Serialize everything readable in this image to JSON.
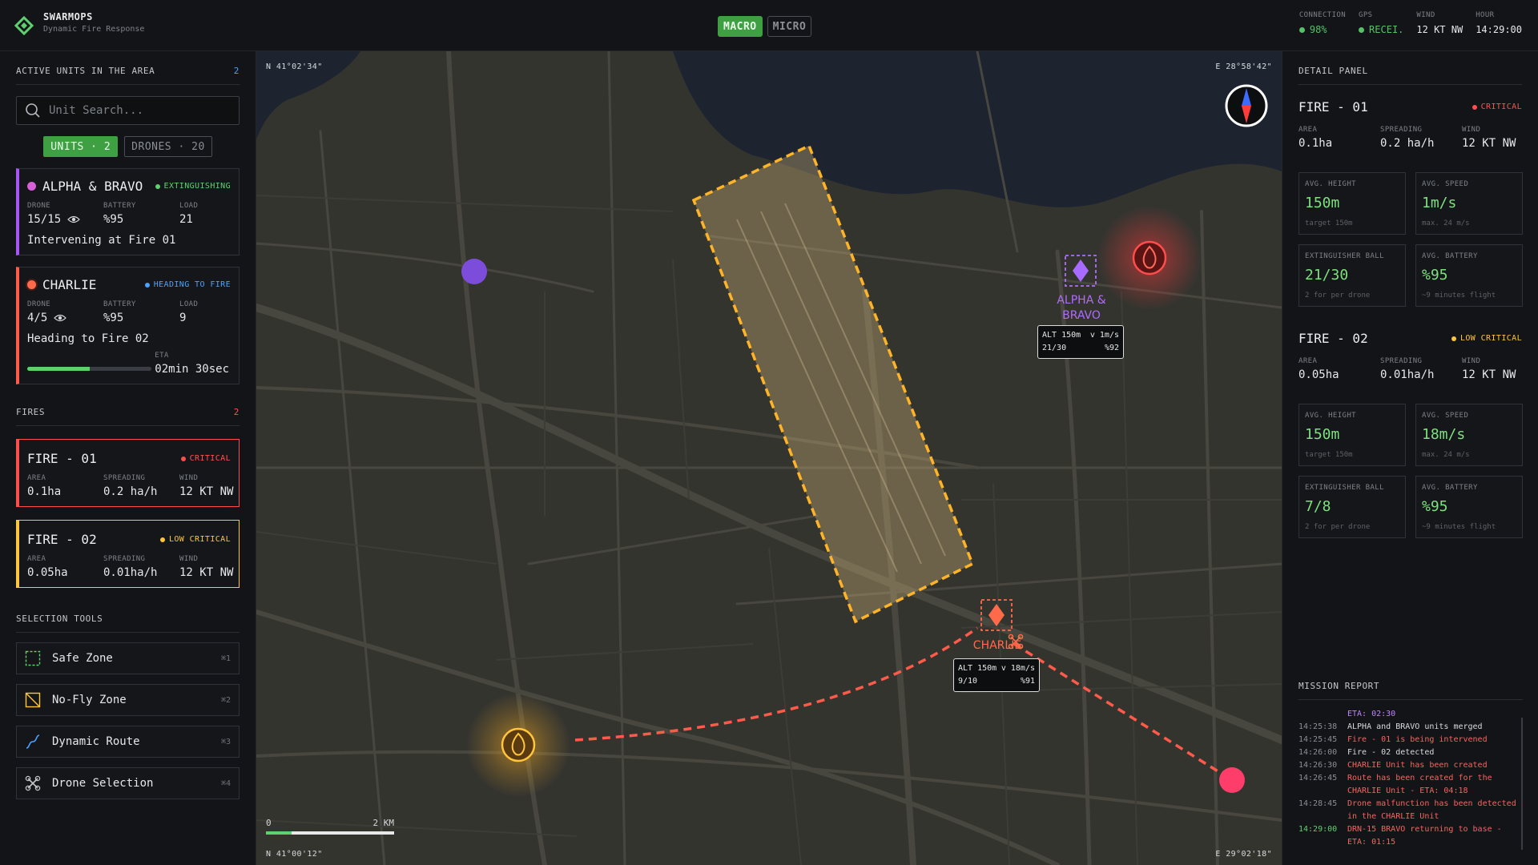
{
  "app": {
    "name": "SWARMOPS",
    "subtitle": "Dynamic Fire Response"
  },
  "mode": {
    "macro": "MACRO",
    "micro": "MICRO",
    "active": "MACRO"
  },
  "status": {
    "connection": {
      "label": "CONNECTION",
      "value": "98%"
    },
    "gps": {
      "label": "GPS",
      "value": "RECEI."
    },
    "wind": {
      "label": "WIND",
      "value": "12 KT NW"
    },
    "hour": {
      "label": "HOUR",
      "value": "14:29:00"
    }
  },
  "left": {
    "units_title": "ACTIVE UNITS IN THE AREA",
    "units_count": "2",
    "search_placeholder": "Unit Search...",
    "filter_units": "UNITS · 2",
    "filter_drones": "DRONES · 20",
    "units": [
      {
        "name": "ALPHA & BRAVO",
        "status": "EXTINGUISHING",
        "drone_label": "DRONE",
        "drone": "15/15",
        "battery_label": "BATTERY",
        "battery": "%95",
        "load_label": "LOAD",
        "load": "21",
        "note": "Intervening at Fire 01",
        "color": "#d75fd7"
      },
      {
        "name": "CHARLIE",
        "status": "HEADING TO FIRE",
        "drone_label": "DRONE",
        "drone": "4/5",
        "battery_label": "BATTERY",
        "battery": "%95",
        "load_label": "LOAD",
        "load": "9",
        "note": "Heading to Fire 02",
        "eta_label": "ETA",
        "eta": "02min 30sec",
        "progress": 0.5,
        "color": "#ff6b4a"
      }
    ],
    "fires_title": "FIRES",
    "fires_count": "2",
    "fires": [
      {
        "name": "FIRE - 01",
        "status": "CRITICAL",
        "area_label": "AREA",
        "area": "0.1ha",
        "spreading_label": "SPREADING",
        "spreading": "0.2 ha/h",
        "wind_label": "WIND",
        "wind": "12 KT NW"
      },
      {
        "name": "FIRE - 02",
        "status": "LOW CRITICAL",
        "area_label": "AREA",
        "area": "0.05ha",
        "spreading_label": "SPREADING",
        "spreading": "0.01ha/h",
        "wind_label": "WIND",
        "wind": "12 KT NW"
      }
    ],
    "tools_title": "SELECTION TOOLS",
    "tools": [
      {
        "label": "Safe Zone",
        "key": "⌘1"
      },
      {
        "label": "No-Fly Zone",
        "key": "⌘2"
      },
      {
        "label": "Dynamic Route",
        "key": "⌘3"
      },
      {
        "label": "Drone Selection",
        "key": "⌘4"
      }
    ]
  },
  "map": {
    "coord_tl": "N 41°02'34\"",
    "coord_tr": "E 28°58'42\"",
    "coord_bl": "N 41°00'12\"",
    "coord_br": "E 29°02'18\"",
    "alpha_label_1": "ALPHA &",
    "alpha_label_2": "BRAVO",
    "alpha_alt": "ALT 150m",
    "alpha_speed": "v 1m/s",
    "alpha_load": "21/30",
    "alpha_batt": "%92",
    "charlie_label": "CHARLIE",
    "charlie_alt": "ALT 150m",
    "charlie_speed": "v 18m/s",
    "charlie_load": "9/10",
    "charlie_batt": "%91",
    "scale_start": "0",
    "scale_end": "2 KM"
  },
  "right": {
    "title": "DETAIL PANEL",
    "fires": [
      {
        "name": "FIRE - 01",
        "status": "CRITICAL",
        "area_label": "AREA",
        "area": "0.1ha",
        "spreading_label": "SPREADING",
        "spreading": "0.2 ha/h",
        "wind_label": "WIND",
        "wind": "12 KT NW",
        "metrics": [
          {
            "label": "AVG. HEIGHT",
            "value": "150m",
            "sub": "target 150m"
          },
          {
            "label": "AVG. SPEED",
            "value": "1m/s",
            "sub": "max. 24 m/s"
          },
          {
            "label": "EXTINGUISHER BALL",
            "value": "21/30",
            "sub": "2 for per drone"
          },
          {
            "label": "AVG. BATTERY",
            "value": "%95",
            "sub": "~9 minutes flight"
          }
        ]
      },
      {
        "name": "FIRE - 02",
        "status": "LOW CRITICAL",
        "area_label": "AREA",
        "area": "0.05ha",
        "spreading_label": "SPREADING",
        "spreading": "0.01ha/h",
        "wind_label": "WIND",
        "wind": "12 KT NW",
        "metrics": [
          {
            "label": "AVG. HEIGHT",
            "value": "150m",
            "sub": "target 150m"
          },
          {
            "label": "AVG. SPEED",
            "value": "18m/s",
            "sub": "max. 24 m/s"
          },
          {
            "label": "EXTINGUISHER BALL",
            "value": "7/8",
            "sub": "2 for per drone"
          },
          {
            "label": "AVG. BATTERY",
            "value": "%95",
            "sub": "~9  minutes flight"
          }
        ]
      }
    ],
    "report_title": "MISSION REPORT",
    "log": [
      {
        "time": "",
        "text": "ETA: 02:30",
        "cls": "c-purple"
      },
      {
        "time": "14:25:38",
        "text": "ALPHA and BRAVO units merged",
        "cls": ""
      },
      {
        "time": "14:25:45",
        "text": "Fire - 01 is being intervened",
        "cls": "c-red"
      },
      {
        "time": "14:26:00",
        "text": "Fire - 02 detected",
        "cls": ""
      },
      {
        "time": "14:26:30",
        "text": "CHARLIE Unit has been created",
        "cls": "c-red"
      },
      {
        "time": "14:26:45",
        "text": "Route has been created for the CHARLIE Unit - ETA: 04:18",
        "cls": "c-red"
      },
      {
        "time": "14:28:45",
        "text": "Drone malfunction has been detected in the CHARLIE Unit",
        "cls": "c-red"
      },
      {
        "time": "14:29:00",
        "text": "DRN-15 BRAVO returning to base - ETA: 01:15",
        "cls": "c-red",
        "time_cls": "c-green"
      }
    ]
  },
  "colors": {
    "accent": "#3fa043",
    "critical": "#ff4d4d",
    "low_critical": "#ffc53d",
    "alpha": "#a855f7",
    "charlie": "#ff6b4a",
    "map_bg": "#34342f"
  }
}
